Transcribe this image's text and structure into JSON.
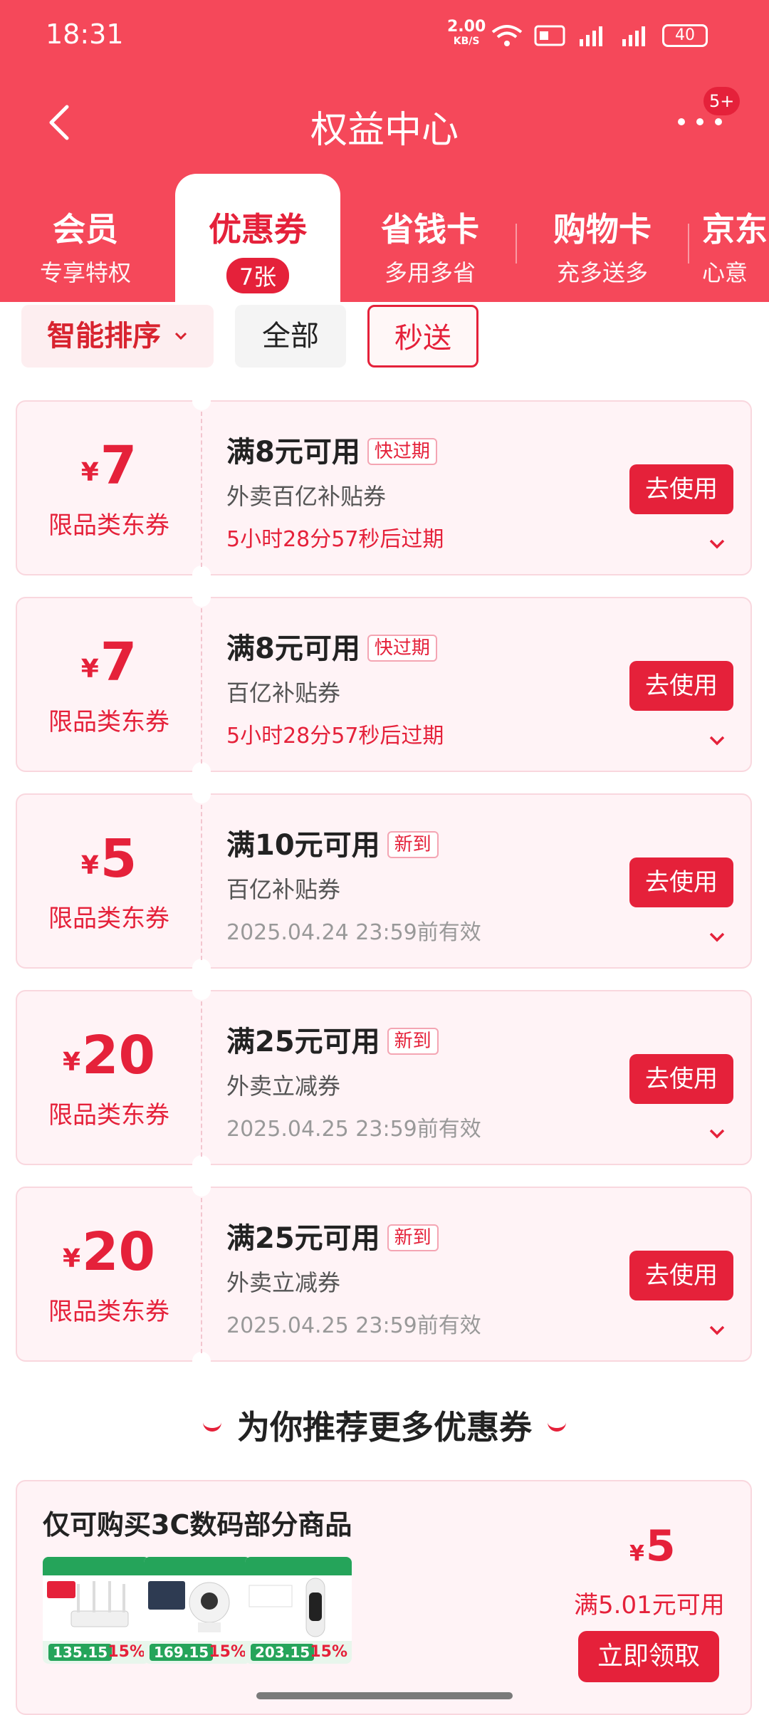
{
  "status": {
    "time": "18:31",
    "net_speed": "2.00",
    "net_unit": "KB/S",
    "battery": "40"
  },
  "header": {
    "title": "权益中心",
    "more_badge": "5+"
  },
  "tabs": [
    {
      "label": "会员",
      "sub": "专享特权"
    },
    {
      "label": "优惠券",
      "sub": "7张"
    },
    {
      "label": "省钱卡",
      "sub": "多用多省"
    },
    {
      "label": "购物卡",
      "sub": "充多送多"
    },
    {
      "label": "京东",
      "sub": "心意"
    }
  ],
  "filters": {
    "sort": "智能排序",
    "all": "全部",
    "instant": "秒送"
  },
  "coupons": [
    {
      "amount": "7",
      "scope": "限品类东券",
      "condition": "满8元可用",
      "tag": "快过期",
      "name": "外卖百亿补贴券",
      "expiry": "5小时28分57秒后过期",
      "button": "去使用"
    },
    {
      "amount": "7",
      "scope": "限品类东券",
      "condition": "满8元可用",
      "tag": "快过期",
      "name": "百亿补贴券",
      "expiry": "5小时28分57秒后过期",
      "button": "去使用"
    },
    {
      "amount": "5",
      "scope": "限品类东券",
      "condition": "满10元可用",
      "tag": "新到",
      "name": "百亿补贴券",
      "expiry": "2025.04.24 23:59前有效",
      "button": "去使用"
    },
    {
      "amount": "20",
      "scope": "限品类东券",
      "condition": "满25元可用",
      "tag": "新到",
      "name": "外卖立减券",
      "expiry": "2025.04.25 23:59前有效",
      "button": "去使用"
    },
    {
      "amount": "20",
      "scope": "限品类东券",
      "condition": "满25元可用",
      "tag": "新到",
      "name": "外卖立减券",
      "expiry": "2025.04.25 23:59前有效",
      "button": "去使用"
    }
  ],
  "currency": "¥",
  "recommend": {
    "title": "为你推荐更多优惠券",
    "card_title": "仅可购买3C数码部分商品",
    "products": [
      {
        "price": "135.15",
        "discount": "15%"
      },
      {
        "price": "169.15",
        "discount": "15%"
      },
      {
        "price": "203.15",
        "discount": "15%"
      }
    ],
    "amount": "5",
    "condition": "满5.01元可用",
    "button": "立即领取"
  },
  "colors": {
    "brand": "#f5485a",
    "accent": "#e5213a"
  }
}
